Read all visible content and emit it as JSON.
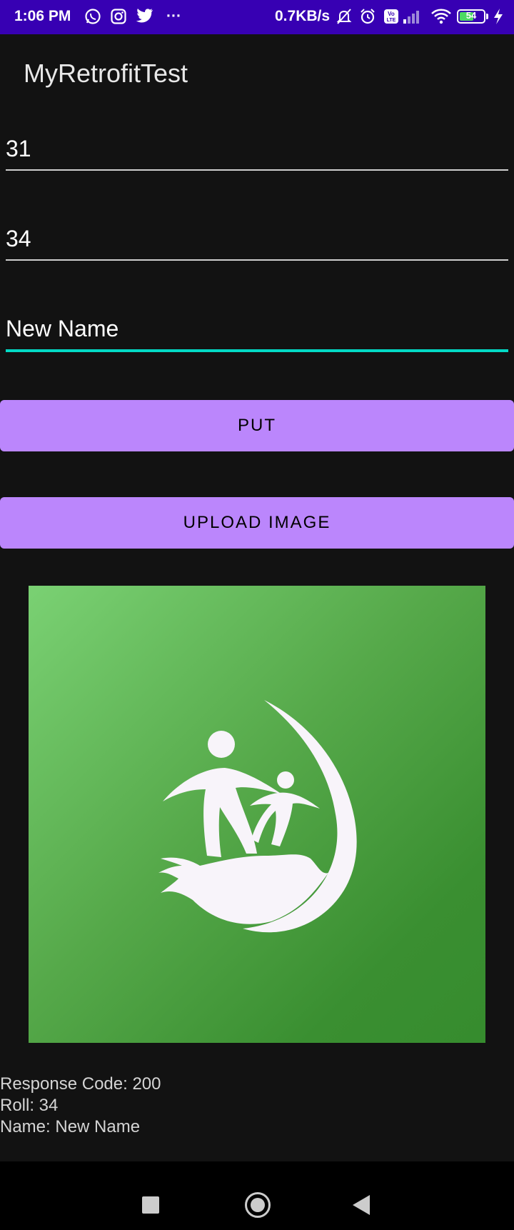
{
  "status_bar": {
    "time": "1:06 PM",
    "dots": "···",
    "net_speed": "0.7KB/s",
    "battery_level": "54",
    "icons": [
      "whatsapp-icon",
      "instagram-icon",
      "twitter-icon",
      "mute-bell-icon",
      "alarm-icon",
      "volte-icon",
      "signal-icon",
      "wifi-icon",
      "charging-icon"
    ]
  },
  "app_bar": {
    "title": "MyRetrofitTest"
  },
  "form": {
    "id_value": "31",
    "roll_value": "34",
    "name_value": "New Name"
  },
  "buttons": {
    "put_label": "PUT",
    "upload_label": "UPLOAD IMAGE"
  },
  "image": {
    "icon": "family-care-logo-icon"
  },
  "response": {
    "code": "Response Code: 200",
    "roll": "Roll: 34",
    "name": "Name: New Name"
  },
  "nav_bar": {
    "icons": [
      "recents-icon",
      "home-icon",
      "back-icon"
    ]
  },
  "colors": {
    "status_bar": "#3700b3",
    "background": "#121212",
    "button": "#bb86fc",
    "accent": "#03dac5",
    "image_green": "#56a94a"
  }
}
